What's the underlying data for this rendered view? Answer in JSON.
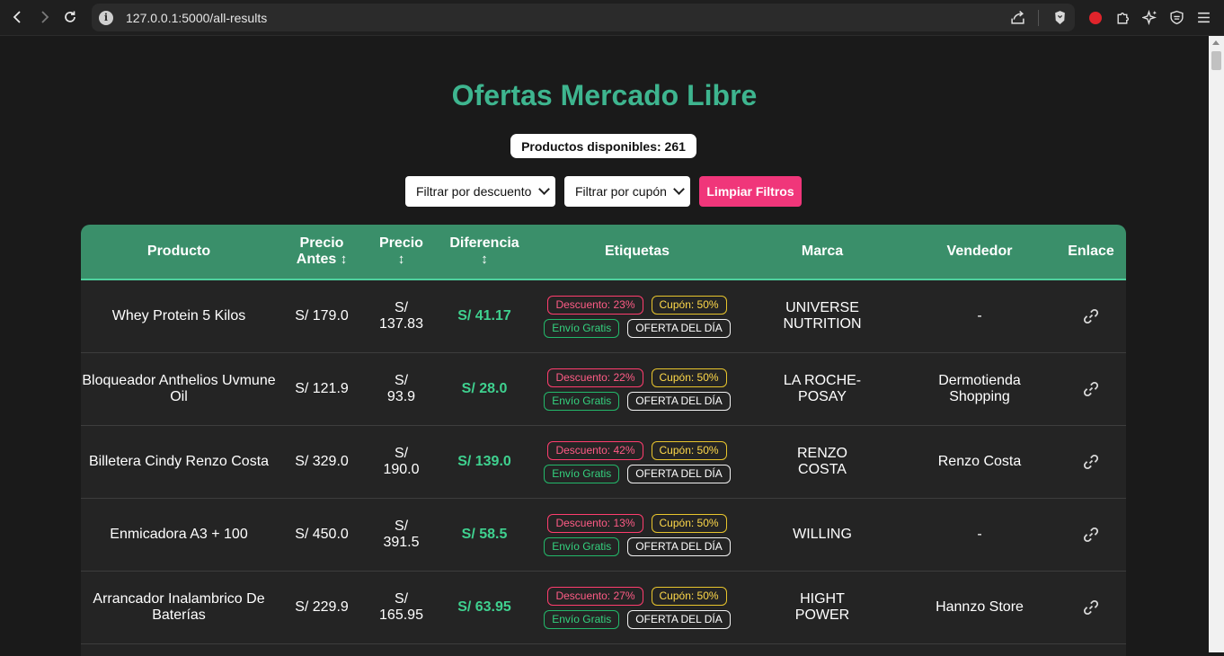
{
  "browser": {
    "url": "127.0.0.1:5000/all-results"
  },
  "page": {
    "title": "Ofertas Mercado Libre",
    "count_label": "Productos disponibles: 261",
    "filter_discount": "Filtrar por descuento",
    "filter_coupon": "Filtrar por cupón",
    "clear_button": "Limpiar Filtros"
  },
  "table": {
    "headers": {
      "product": "Producto",
      "price_before_l1": "Precio",
      "price_before_l2": "Antes",
      "price": "Precio",
      "difference": "Diferencia",
      "tags": "Etiquetas",
      "brand": "Marca",
      "seller": "Vendedor",
      "link": "Enlace",
      "sort_symbol": "↕"
    },
    "rows": [
      {
        "product": "Whey Protein 5 Kilos",
        "before": "S/ 179.0",
        "price": "S/ 137.83",
        "diff": "S/ 41.17",
        "discount": "Descuento: 23%",
        "coupon": "Cupón: 50%",
        "shipping": "Envío Gratis",
        "deal": "OFERTA DEL DÍA",
        "brand": "UNIVERSE NUTRITION",
        "seller": "-"
      },
      {
        "product": "Bloqueador Anthelios Uvmune Oil",
        "before": "S/ 121.9",
        "price": "S/ 93.9",
        "diff": "S/ 28.0",
        "discount": "Descuento: 22%",
        "coupon": "Cupón: 50%",
        "shipping": "Envío Gratis",
        "deal": "OFERTA DEL DÍA",
        "brand": "LA ROCHE-POSAY",
        "seller": "Dermotienda Shopping"
      },
      {
        "product": "Billetera Cindy Renzo Costa",
        "before": "S/ 329.0",
        "price": "S/ 190.0",
        "diff": "S/ 139.0",
        "discount": "Descuento: 42%",
        "coupon": "Cupón: 50%",
        "shipping": "Envío Gratis",
        "deal": "OFERTA DEL DÍA",
        "brand": "RENZO COSTA",
        "seller": "Renzo Costa"
      },
      {
        "product": "Enmicadora A3 + 100",
        "before": "S/ 450.0",
        "price": "S/ 391.5",
        "diff": "S/ 58.5",
        "discount": "Descuento: 13%",
        "coupon": "Cupón: 50%",
        "shipping": "Envío Gratis",
        "deal": "OFERTA DEL DÍA",
        "brand": "WILLING",
        "seller": "-"
      },
      {
        "product": "Arrancador Inalambrico De Baterías",
        "before": "S/ 229.9",
        "price": "S/ 165.95",
        "diff": "S/ 63.95",
        "discount": "Descuento: 27%",
        "coupon": "Cupón: 50%",
        "shipping": "Envío Gratis",
        "deal": "OFERTA DEL DÍA",
        "brand": "HIGHT POWER",
        "seller": "Hannzo Store"
      }
    ]
  }
}
